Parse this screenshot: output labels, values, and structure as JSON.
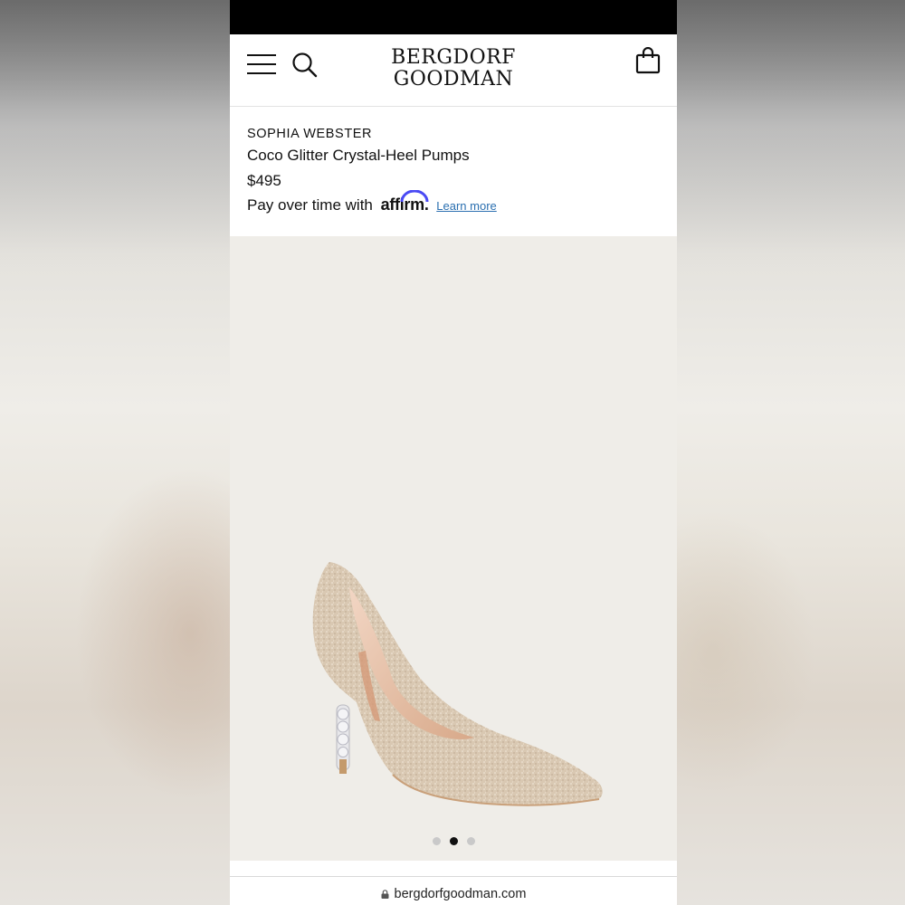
{
  "header": {
    "logo_line1": "BERGDORF",
    "logo_line2": "GOODMAN",
    "menu_icon": "hamburger-menu-icon",
    "search_icon": "search-icon",
    "bag_icon": "shopping-bag-icon"
  },
  "product": {
    "brand": "SOPHIA WEBSTER",
    "name": "Coco Glitter Crystal-Heel Pumps",
    "price": "$495",
    "financing_text": "Pay over time with",
    "affirm_logo": "affirm",
    "affirm_period": ".",
    "learn_more": "Learn more"
  },
  "gallery": {
    "image_alt": "glitter pump with crystal heel",
    "total_images": 3,
    "active_index": 2
  },
  "browser": {
    "url": "bergdorfgoodman.com",
    "lock_icon": "lock-icon"
  },
  "colors": {
    "link": "#2a6fb0",
    "affirm_arc": "#4a4af4",
    "gallery_bg": "#efede8",
    "status_bar": "#000000"
  }
}
